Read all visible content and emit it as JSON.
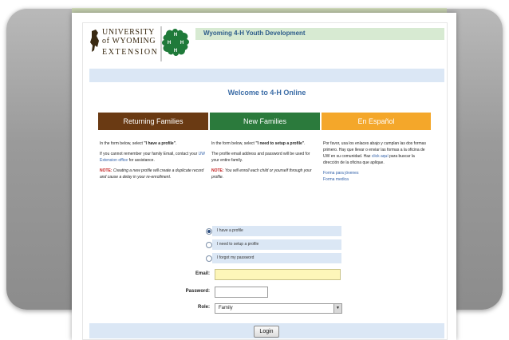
{
  "header": {
    "university_line1": "UNIVERSITY",
    "university_line2": "of WYOMING",
    "extension": "EXTENSION",
    "title": "Wyoming 4-H Youth Development"
  },
  "welcome": "Welcome to 4-H Online",
  "columns": [
    {
      "heading": "Returning Families",
      "color": "#6a3a13",
      "p1_pre": "In the form below, select ",
      "p1_bold": "\"I have a profile\"",
      "p1_post": ".",
      "p2_pre": "If you cannot remember your family Email, contact your ",
      "p2_link": "UW Extension office",
      "p2_post": " for assistance.",
      "note_label": "NOTE:",
      "note": " Creating a new profile will create a duplicate record and cause a delay in your re-enrollment."
    },
    {
      "heading": "New Families",
      "color": "#2b7a3c",
      "p1_pre": "In the form below, select ",
      "p1_bold": "\"I need to setup a profile\"",
      "p1_post": ".",
      "p2": "The profile email address and password will be used for your entire family.",
      "note_label": "NOTE:",
      "note": " You will enroll each child or yourself through your profile."
    },
    {
      "heading": "En Español",
      "color": "#f4a72a",
      "p1_pre": "Por favor, usa los enlaces abajo y cumplan las dos formas primero. Hay que llevar o enviar las formas a la oficina de UW en su comunidad. Haz ",
      "p1_link": "click aquí",
      "p1_post": " para buscar la dirección de la oficina que aplique.",
      "link1": "Forma para jóvenes",
      "link2": "Forma medica"
    }
  ],
  "login": {
    "options": [
      {
        "label": "I have a profile",
        "selected": true
      },
      {
        "label": "I need to setup a profile",
        "selected": false
      },
      {
        "label": "I forgot my password",
        "selected": false
      }
    ],
    "email_label": "Email:",
    "email_value": "",
    "password_label": "Password:",
    "password_value": "",
    "role_label": "Role:",
    "role_value": "Family",
    "login_button": "Login"
  }
}
